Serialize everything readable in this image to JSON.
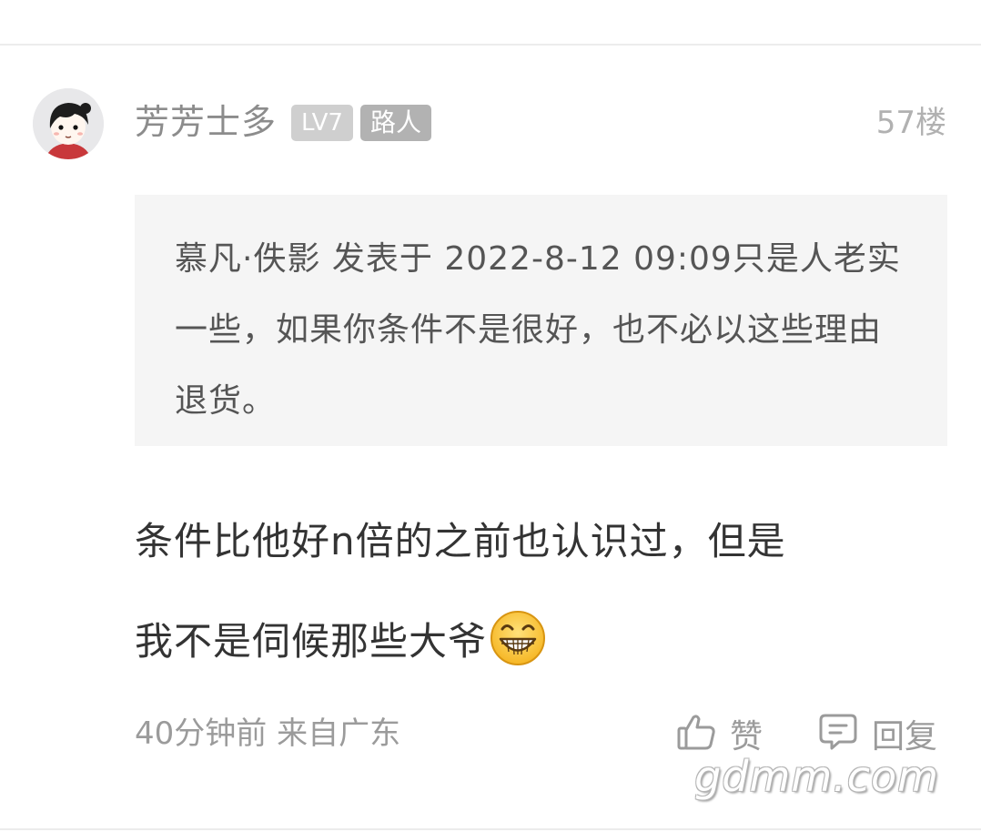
{
  "comment": {
    "username": "芳芳士多",
    "level_badge": "LV7",
    "role_badge": "路人",
    "floor": "57楼",
    "quote": {
      "text": "慕凡·佚影 发表于 2022-8-12 09:09只是人老实一些，如果你条件不是很好，也不必以这些理由退货。"
    },
    "body_line1": "条件比他好n倍的之前也认识过，但是",
    "body_line2": "我不是伺候那些大爷",
    "emoji": "grinning-face",
    "time": "40分钟前",
    "location": "来自广东",
    "meta": "40分钟前 来自广东",
    "like_label": "赞",
    "reply_label": "回复"
  },
  "watermark": "gdmm.com",
  "icons": {
    "like": "thumbs-up-icon",
    "reply": "comment-bubble-icon"
  },
  "colors": {
    "username": "#8c8c8c",
    "badge_level": "#cfcfcf",
    "badge_role": "#b2b2b2",
    "quote_bg": "#f5f5f5",
    "body_text": "#333333",
    "meta_text": "#9b9b9b"
  }
}
